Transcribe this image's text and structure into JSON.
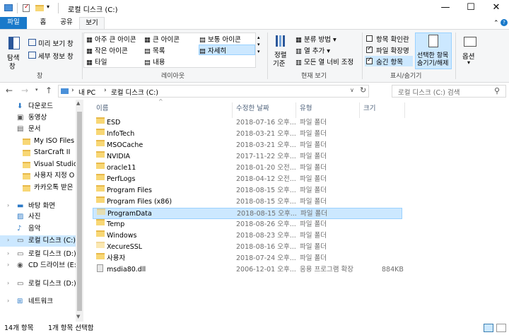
{
  "window": {
    "title": "로컬 디스크 (C:)",
    "minimize": "—",
    "maximize": "☐",
    "close": "✕"
  },
  "ribbon_tabs": [
    "파일",
    "홈",
    "공유",
    "보기"
  ],
  "ribbon": {
    "pane": {
      "nav_pane": "탐색",
      "nav_pane2": "창",
      "preview": "미리 보기 창",
      "details": "세부 정보 창",
      "label": "창"
    },
    "layout": {
      "items": [
        "아주 큰 아이콘",
        "큰 아이콘",
        "보통 아이콘",
        "작은 아이콘",
        "목록",
        "자세히",
        "타일",
        "내용"
      ],
      "label": "레이아웃"
    },
    "current_view": {
      "sort": "정렬",
      "sort2": "기준",
      "group_by": "분류 방법",
      "add_columns": "열 추가",
      "fit_columns": "모든 열 너비 조정",
      "label": "현재 보기"
    },
    "show_hide": {
      "item_checkboxes": "항목 확인란",
      "file_extensions": "파일 확장명",
      "hidden_items": "숨긴 항목",
      "hide_selected": "선택한 항목",
      "hide_selected2": "숨기기/해제",
      "label": "표시/숨기기"
    },
    "options": "옵션"
  },
  "address": {
    "path": [
      "내 PC",
      "로컬 디스크 (C:)"
    ],
    "search_placeholder": "로컬 디스크 (C:) 검색"
  },
  "nav_pane": [
    {
      "label": "다운로드",
      "icon": "download-icon"
    },
    {
      "label": "동영상",
      "icon": "video-icon"
    },
    {
      "label": "문서",
      "icon": "document-icon"
    },
    {
      "label": "My ISO Files",
      "icon": "folder-icon"
    },
    {
      "label": "StarCraft II",
      "icon": "folder-icon"
    },
    {
      "label": "Visual Studio 2",
      "icon": "folder-icon"
    },
    {
      "label": "사용자 지정 O",
      "icon": "folder-icon"
    },
    {
      "label": "카카오톡 받은",
      "icon": "folder-icon"
    },
    {
      "label": "바탕 화면",
      "icon": "desktop-icon"
    },
    {
      "label": "사진",
      "icon": "pictures-icon"
    },
    {
      "label": "음악",
      "icon": "music-icon"
    },
    {
      "label": "로컬 디스크 (C:)",
      "icon": "drive-icon",
      "selected": true
    },
    {
      "label": "로컬 디스크 (D:)",
      "icon": "drive-icon"
    },
    {
      "label": "CD 드라이브 (E:",
      "icon": "cd-drive-icon"
    },
    {
      "label": "로컬 디스크 (D:)",
      "icon": "drive-icon"
    },
    {
      "label": "네트워크",
      "icon": "network-icon"
    }
  ],
  "columns": [
    "이름",
    "수정한 날짜",
    "유형",
    "크기"
  ],
  "files": [
    {
      "name": "ESD",
      "date": "2018-07-16 오후...",
      "type": "파일 폴더",
      "size": "",
      "kind": "folder"
    },
    {
      "name": "InfoTech",
      "date": "2018-03-21 오후...",
      "type": "파일 폴더",
      "size": "",
      "kind": "folder"
    },
    {
      "name": "MSOCache",
      "date": "2018-03-21 오후...",
      "type": "파일 폴더",
      "size": "",
      "kind": "folder"
    },
    {
      "name": "NVIDIA",
      "date": "2017-11-22 오후...",
      "type": "파일 폴더",
      "size": "",
      "kind": "folder"
    },
    {
      "name": "oracle11",
      "date": "2018-01-20 오전...",
      "type": "파일 폴더",
      "size": "",
      "kind": "folder"
    },
    {
      "name": "PerfLogs",
      "date": "2018-04-12 오전...",
      "type": "파일 폴더",
      "size": "",
      "kind": "folder"
    },
    {
      "name": "Program Files",
      "date": "2018-08-15 오후...",
      "type": "파일 폴더",
      "size": "",
      "kind": "folder"
    },
    {
      "name": "Program Files (x86)",
      "date": "2018-08-15 오후...",
      "type": "파일 폴더",
      "size": "",
      "kind": "folder"
    },
    {
      "name": "ProgramData",
      "date": "2018-08-15 오후...",
      "type": "파일 폴더",
      "size": "",
      "kind": "folder-hidden",
      "selected": true
    },
    {
      "name": "Temp",
      "date": "2018-08-26 오후...",
      "type": "파일 폴더",
      "size": "",
      "kind": "folder"
    },
    {
      "name": "Windows",
      "date": "2018-08-23 오후...",
      "type": "파일 폴더",
      "size": "",
      "kind": "folder"
    },
    {
      "name": "XecureSSL",
      "date": "2018-08-16 오후...",
      "type": "파일 폴더",
      "size": "",
      "kind": "folder-hidden"
    },
    {
      "name": "사용자",
      "date": "2018-07-24 오후...",
      "type": "파일 폴더",
      "size": "",
      "kind": "folder"
    },
    {
      "name": "msdia80.dll",
      "date": "2006-12-01 오후...",
      "type": "응용 프로그램 확장",
      "size": "884KB",
      "kind": "dll"
    }
  ],
  "status": {
    "count": "14개 항목",
    "selected": "1개 항목 선택함"
  },
  "colors": {
    "file_tab": "#1979ca",
    "selection": "#cce8ff",
    "selection_border": "#99d1ff",
    "folder": "#f8d775"
  }
}
